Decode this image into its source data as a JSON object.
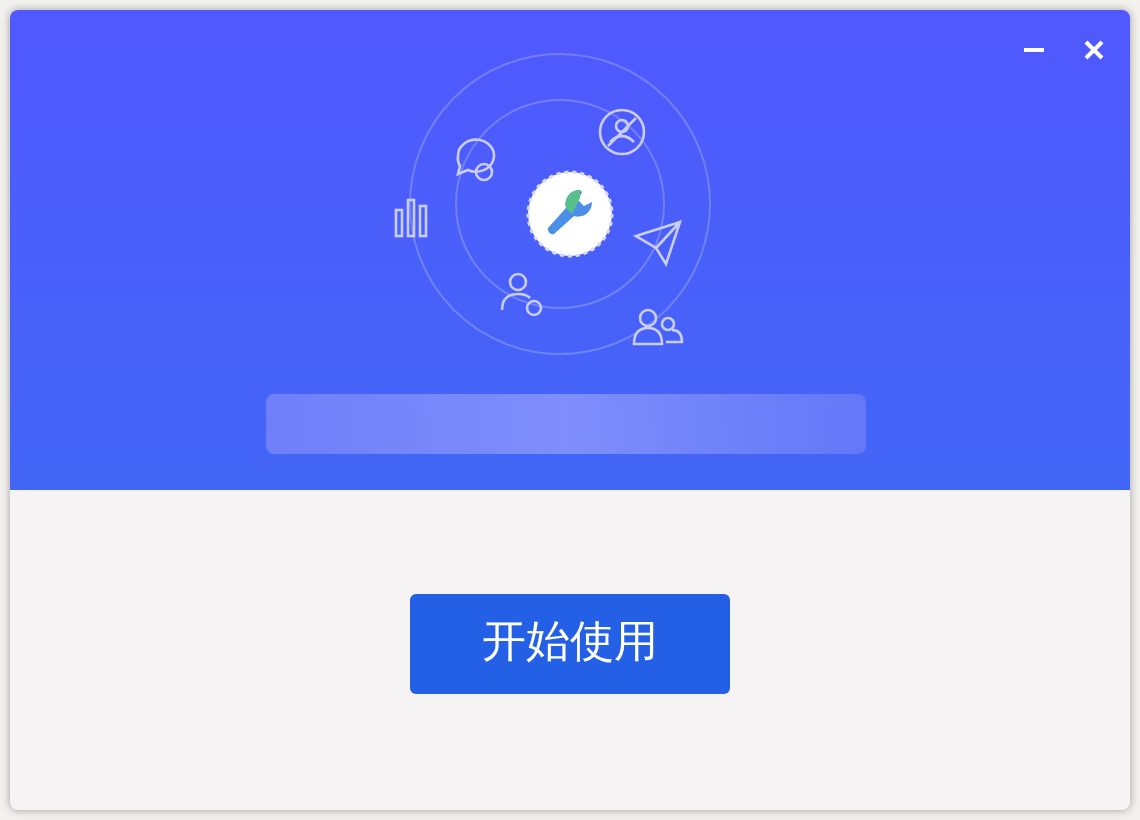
{
  "dialog": {
    "start_button": "开始使用"
  }
}
